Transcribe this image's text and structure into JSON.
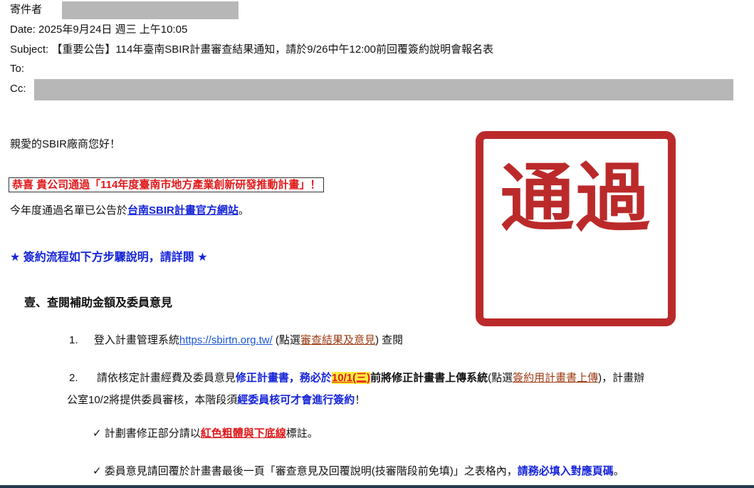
{
  "header": {
    "from_label": "寄件者",
    "date_line": "Date: 2025年9月24日 週三 上午10:05",
    "subject_line": "Subject: 【重要公告】114年臺南SBIR計畫審查結果通知，請於9/26中午12:00前回覆簽約說明會報名表",
    "to_label": "To:",
    "cc_label": "Cc:"
  },
  "body": {
    "greeting": "親愛的SBIR廠商您好！",
    "congrats": "恭喜 貴公司通過「114年度臺南市地方產業創新研發推動計畫」！",
    "announce_prefix": "今年度通過名單已公告於",
    "announce_link": "台南SBIR計畫官方網站",
    "announce_suffix": "。",
    "process_title": "★ 簽約流程如下方步驟說明，請詳閱 ★",
    "section1_title": "壹、查閱補助金額及委員意見",
    "step1": {
      "num": "1.",
      "prefix": "登入計畫管理系統",
      "link": "https://sbirtn.org.tw/",
      "mid": " (點選",
      "link2": "審查結果及意見",
      "suffix": ") 查閱"
    },
    "step2": {
      "num": "2.",
      "p1": "請依核定計畫經費及委員意見",
      "b1": "修正計畫書，務必於",
      "date": "10/1(三)",
      "b2": "前將修正計畫書上傳系統",
      "p2": "(點選",
      "link": "簽約用計畫書上傳",
      "p3": ")，計畫辦",
      "line2_prefix": "公室10/2將提供委員審核，本階段須",
      "line2_bold": "經委員核可才會進行簽約",
      "line2_suffix": "！"
    },
    "check1": {
      "mark": "✓",
      "prefix": "計劃書修正部分請以",
      "emph": "紅色粗體與下底線",
      "suffix": "標註。"
    },
    "check2": {
      "mark": "✓",
      "prefix": "委員意見請回覆於計畫書最後一頁「審查意見及回覆說明(技審階段前免填)」之表格內，",
      "emph": "請務必填入對應頁碼",
      "suffix": "。"
    }
  },
  "stamp": {
    "text": "通過",
    "color": "#bb2a2b"
  },
  "colors": {
    "accent_red": "#e0191b",
    "accent_blue": "#1524d8",
    "highlight": "#ffeb3b",
    "link": "#1a56d6"
  }
}
